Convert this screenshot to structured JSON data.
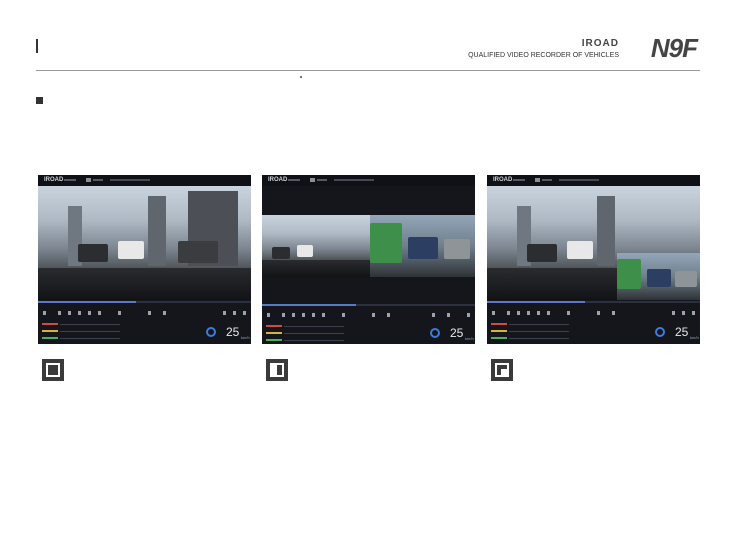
{
  "header": {
    "brand_small": "IROAD",
    "brand_tagline": "QUALIFIED VIDEO RECORDER OF VEHICLES",
    "brand_logo": "N9F"
  },
  "screens": [
    {
      "logo": "IROAD",
      "speed": "25",
      "unit": "km/h",
      "layout": "single-view"
    },
    {
      "logo": "IROAD",
      "speed": "25",
      "unit": "km/h",
      "layout": "split-view"
    },
    {
      "logo": "IROAD",
      "speed": "25",
      "unit": "km/h",
      "layout": "picture-in-picture"
    }
  ],
  "layout_icons": [
    "single-view-icon",
    "split-view-icon",
    "pip-view-icon"
  ],
  "colors": {
    "accent": "#3f7bd8",
    "dark": "#14161c"
  }
}
